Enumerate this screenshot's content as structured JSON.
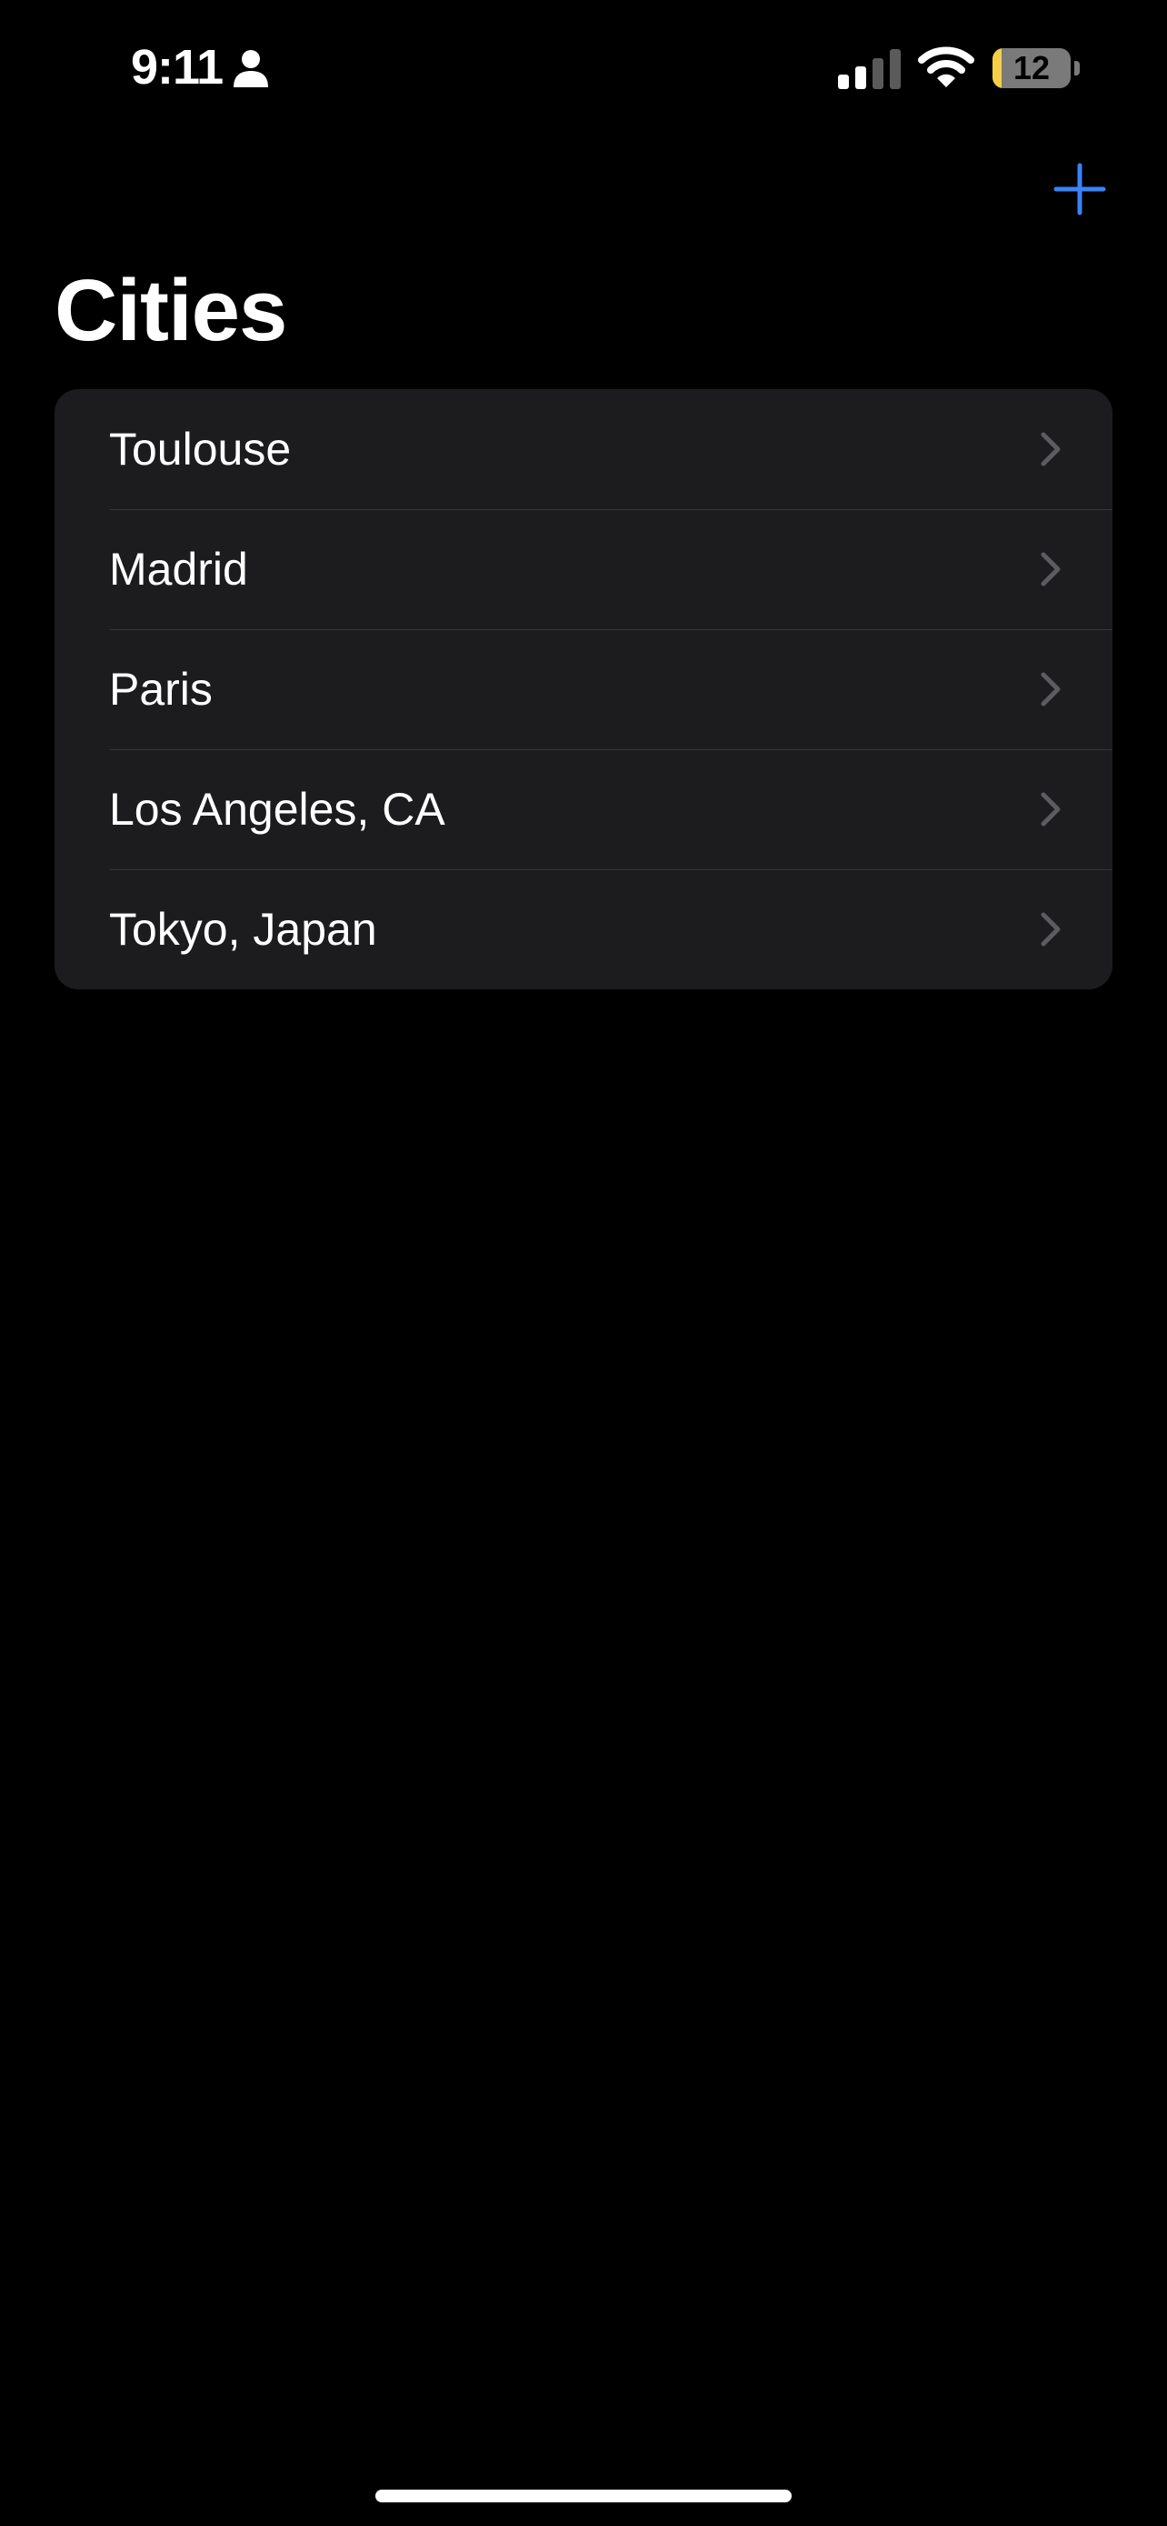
{
  "status_bar": {
    "time": "9:11",
    "battery_level": "12",
    "battery_fill_color": "#f5cf4a",
    "icons": [
      "person-icon",
      "cellular-signal-icon",
      "wifi-icon",
      "battery-icon"
    ]
  },
  "nav": {
    "add_icon": "plus-icon",
    "accent_color": "#3a82f7"
  },
  "page": {
    "title": "Cities"
  },
  "cities": [
    {
      "label": "Toulouse",
      "icon": "chevron-right-icon"
    },
    {
      "label": "Madrid",
      "icon": "chevron-right-icon"
    },
    {
      "label": "Paris",
      "icon": "chevron-right-icon"
    },
    {
      "label": "Los Angeles, CA",
      "icon": "chevron-right-icon"
    },
    {
      "label": "Tokyo, Japan",
      "icon": "chevron-right-icon"
    }
  ]
}
